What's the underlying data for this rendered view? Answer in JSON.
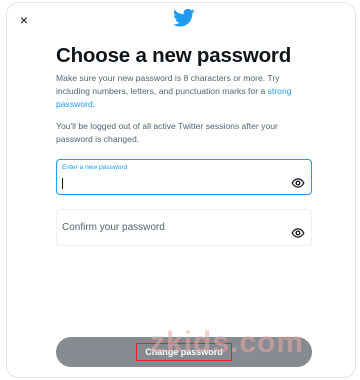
{
  "dialog": {
    "close_glyph": "×",
    "logo_icon": "twitter-bird-icon",
    "title": "Choose a new password",
    "description_text": "Make sure your new password is 8 characters or more. Try including numbers, letters, and punctuation marks for a ",
    "description_link": "strong password",
    "description_end": ".",
    "note": "You'll be logged out of all active Twitter sessions after your password is changed."
  },
  "fields": {
    "new_password": {
      "label": "Enter a new password",
      "value": "",
      "icon": "eye-icon"
    },
    "confirm_password": {
      "label": "Confirm your password",
      "value": "",
      "icon": "eye-icon"
    }
  },
  "actions": {
    "submit_label": "Change password"
  },
  "watermark": {
    "text": "zkids.com"
  },
  "colors": {
    "accent": "#1d9bf0",
    "button_bg": "#858b90",
    "text": "#0f1419",
    "muted": "#536471"
  }
}
